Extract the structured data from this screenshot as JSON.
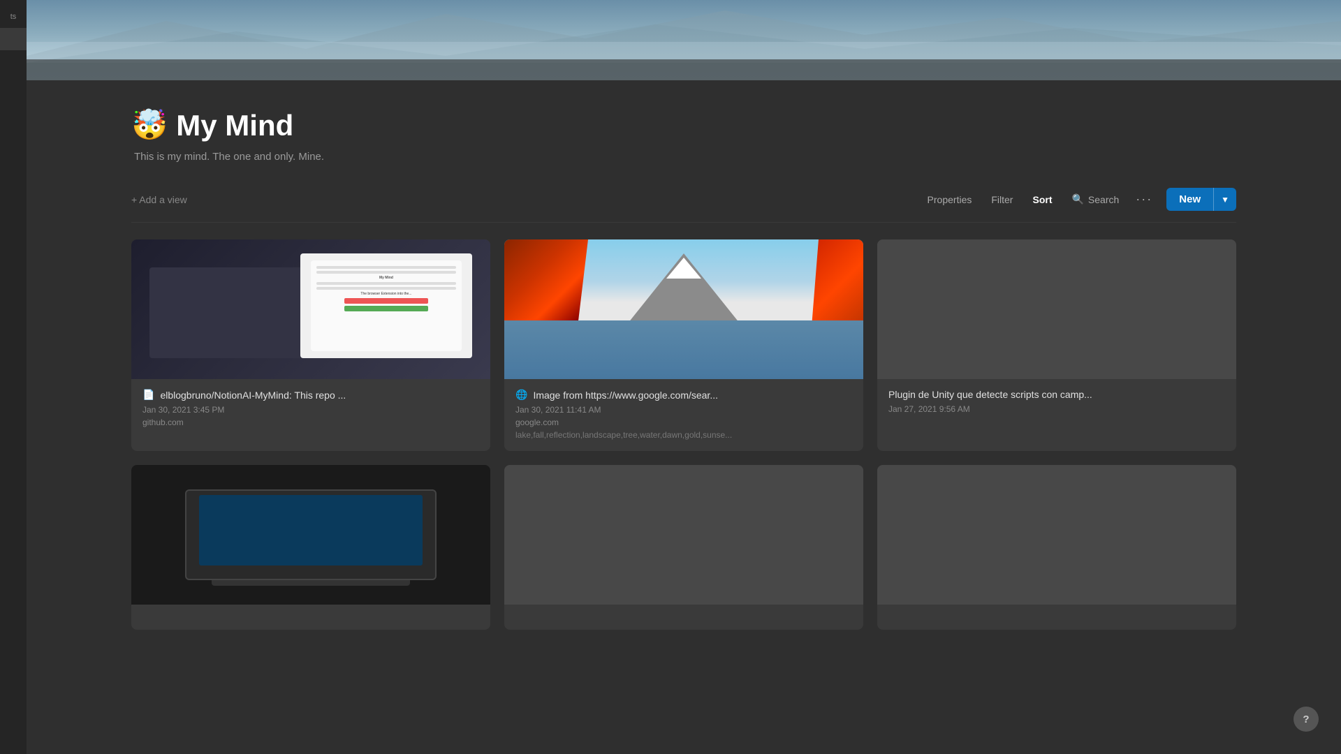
{
  "sidebar": {
    "items": [
      {
        "label": "ts",
        "active": false
      },
      {
        "label": "",
        "active": true
      }
    ]
  },
  "hero": {
    "alt": "Mountain lake hero banner"
  },
  "page": {
    "emoji": "🤯",
    "title": "My Mind",
    "description": "This is my mind. The one and only. Mine."
  },
  "toolbar": {
    "add_view_label": "+ Add a view",
    "properties_label": "Properties",
    "filter_label": "Filter",
    "sort_label": "Sort",
    "search_icon_label": "🔍",
    "search_label": "Search",
    "more_label": "···",
    "new_label": "New",
    "new_dropdown_icon": "▼"
  },
  "cards": [
    {
      "id": "card-1",
      "type": "github",
      "icon": "📄",
      "title": "elblogbruno/NotionAI-MyMind: This repo ...",
      "date": "Jan 30, 2021 3:45 PM",
      "domain": "github.com",
      "tags": "",
      "has_image": true
    },
    {
      "id": "card-2",
      "type": "mountain",
      "icon": "🌐",
      "title": "Image from https://www.google.com/sear...",
      "date": "Jan 30, 2021 11:41 AM",
      "domain": "google.com",
      "tags": "lake,fall,reflection,landscape,tree,water,dawn,gold,sunse...",
      "has_image": true
    },
    {
      "id": "card-3",
      "type": "empty",
      "icon": "",
      "title": "Plugin de Unity que detecte scripts con camp...",
      "date": "Jan 27, 2021 9:56 AM",
      "domain": "",
      "tags": "",
      "has_image": false
    },
    {
      "id": "card-4",
      "type": "laptop",
      "icon": "",
      "title": "",
      "date": "",
      "domain": "",
      "tags": "",
      "has_image": true
    },
    {
      "id": "card-5",
      "type": "empty2",
      "icon": "",
      "title": "",
      "date": "",
      "domain": "",
      "tags": "",
      "has_image": false
    },
    {
      "id": "card-6",
      "type": "empty3",
      "icon": "",
      "title": "",
      "date": "",
      "domain": "",
      "tags": "",
      "has_image": false
    }
  ],
  "help": {
    "label": "?"
  }
}
